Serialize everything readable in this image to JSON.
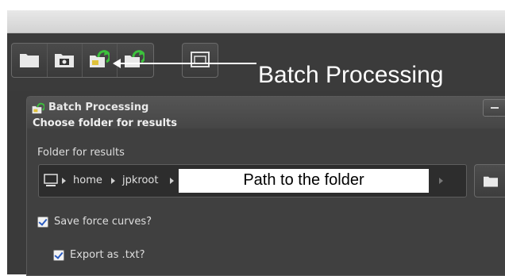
{
  "toolbar": {
    "buttons": [
      {
        "icon": "folder-icon"
      },
      {
        "icon": "camera-icon"
      },
      {
        "icon": "batch-processing-icon"
      },
      {
        "icon": "batch-refresh-icon"
      },
      {
        "icon": "window-icon"
      }
    ],
    "annotation_label": "Batch Processing"
  },
  "dialog": {
    "title": "Batch Processing",
    "subtitle": "Choose folder for results",
    "folder_label": "Folder for results",
    "path": {
      "crumbs": [
        "home",
        "jpkroot"
      ],
      "highlight_text": "Path to the folder"
    },
    "save_force_curves": {
      "label": "Save force curves?",
      "checked": true
    },
    "export_txt": {
      "label": "Export as .txt?",
      "checked": true
    }
  },
  "colors": {
    "accent_green": "#3cc23c",
    "check_blue": "#2a5bbf"
  }
}
